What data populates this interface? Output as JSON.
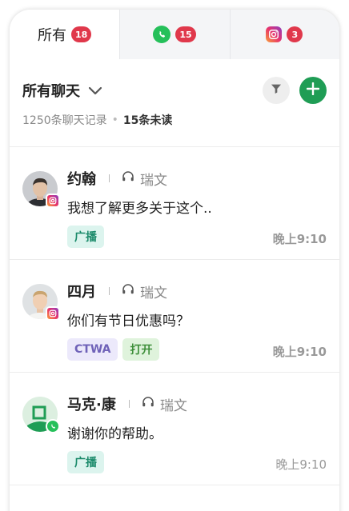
{
  "tabs": [
    {
      "label": "所有",
      "count": "18",
      "icon": null
    },
    {
      "label": "",
      "count": "15",
      "icon": "whatsapp-icon"
    },
    {
      "label": "",
      "count": "3",
      "icon": "instagram-icon"
    }
  ],
  "header": {
    "title": "所有聊天",
    "records": "1250条聊天记录",
    "separator": "•",
    "unread": "15条未读"
  },
  "chats": [
    {
      "name": "约翰",
      "agent": "瑞文",
      "preview": "我想了解更多关于这个..",
      "tags": [
        "广播"
      ],
      "time": "晚上9:10",
      "channel": "instagram"
    },
    {
      "name": "四月",
      "agent": "瑞文",
      "preview": "你们有节日优惠吗？",
      "tags": [
        "CTWA",
        "打开"
      ],
      "time": "晚上9:10",
      "channel": "instagram"
    },
    {
      "name": "马克·康",
      "agent": "瑞文",
      "preview": "谢谢你的帮助。",
      "tags": [
        "广播"
      ],
      "time": "晚上9:10",
      "channel": "whatsapp"
    }
  ],
  "colors": {
    "badge": "#e0384b",
    "add_button": "#1f9d55",
    "whatsapp": "#25c05a"
  }
}
